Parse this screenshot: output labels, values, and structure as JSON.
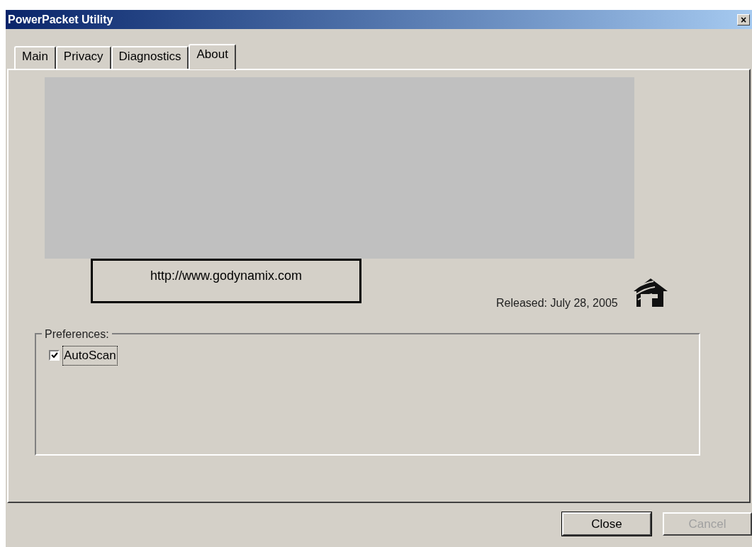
{
  "window": {
    "title": "PowerPacket Utility",
    "close_glyph": "×"
  },
  "tabs": [
    {
      "label": "Main",
      "selected": false
    },
    {
      "label": "Privacy",
      "selected": false
    },
    {
      "label": "Diagnostics",
      "selected": false
    },
    {
      "label": "About",
      "selected": true
    }
  ],
  "about": {
    "url": "http://www.godynamix.com",
    "released": "Released: July 28, 2005"
  },
  "preferences": {
    "title": "Preferences:",
    "options": [
      {
        "label": "AutoScan",
        "checked": true,
        "focused": true
      }
    ]
  },
  "buttons": [
    {
      "label": "Close",
      "disabled": false,
      "default": true
    },
    {
      "label": "Cancel",
      "disabled": true,
      "default": false
    }
  ]
}
